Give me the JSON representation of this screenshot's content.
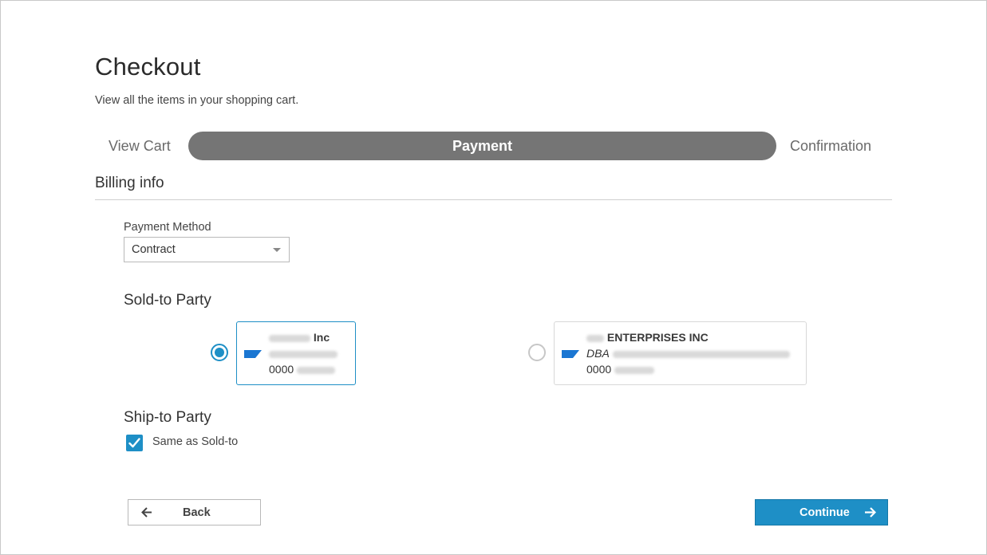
{
  "header": {
    "title": "Checkout",
    "subtitle": "View all the items in your shopping cart."
  },
  "steps": [
    {
      "label": "View Cart",
      "state": "done"
    },
    {
      "label": "Payment",
      "state": "active"
    },
    {
      "label": "Confirmation",
      "state": "pending"
    }
  ],
  "billing": {
    "section_title": "Billing info",
    "payment_method_label": "Payment Method",
    "payment_method_value": "Contract"
  },
  "sold_to": {
    "title": "Sold-to Party",
    "options": [
      {
        "name_suffix": "Inc",
        "id_prefix": "0000",
        "selected": true
      },
      {
        "name_suffix": "ENTERPRISES INC",
        "dba_label": "DBA",
        "id_prefix": "0000",
        "selected": false
      }
    ]
  },
  "ship_to": {
    "title": "Ship-to Party",
    "same_as_label": "Same as Sold-to",
    "same_as_checked": true
  },
  "actions": {
    "back_label": "Back",
    "continue_label": "Continue"
  },
  "colors": {
    "accent": "#1e8fc6",
    "stepper_active": "#757575",
    "brand_logo": "#1a76d2"
  }
}
